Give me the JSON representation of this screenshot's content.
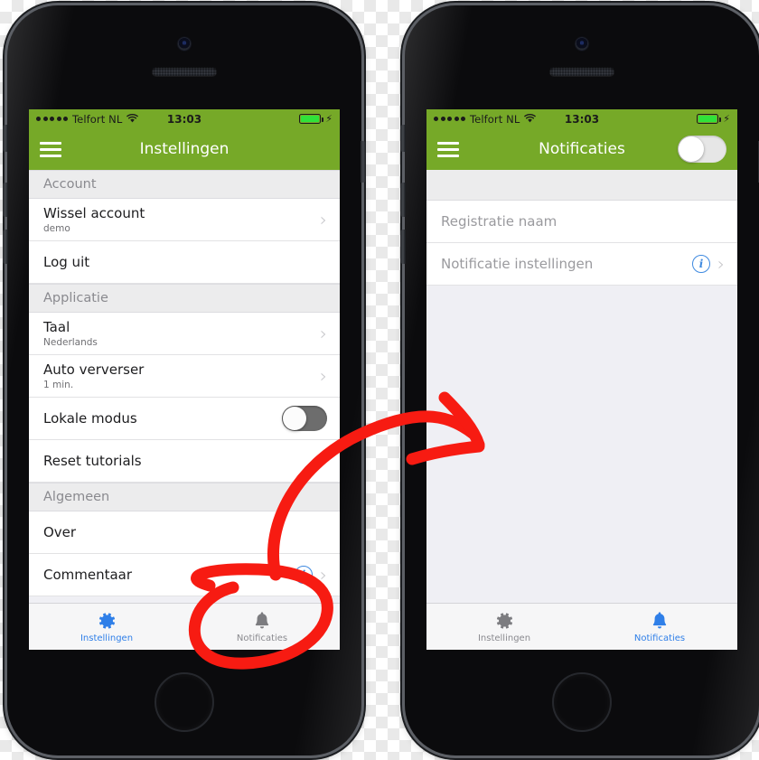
{
  "meta": {
    "accent_green": "#76a928",
    "accent_blue": "#2f7fe8",
    "annotation_red": "#f71b12",
    "inactive_gray": "#8a8a8f"
  },
  "status_bar": {
    "signal_dots": 5,
    "carrier": "Telfort NL",
    "wifi_icon": "wifi-icon",
    "time": "13:03",
    "battery_icon": "battery-full-icon",
    "charging_icon": "lightning-bolt-icon"
  },
  "phone_left": {
    "nav": {
      "menu_icon": "hamburger-menu-icon",
      "title": "Instellingen"
    },
    "sections": [
      {
        "header": "Account",
        "rows": [
          {
            "title": "Wissel account",
            "subtitle": "demo",
            "accessory": "chevron"
          },
          {
            "title": "Log uit",
            "subtitle": "",
            "accessory": "none"
          }
        ]
      },
      {
        "header": "Applicatie",
        "rows": [
          {
            "title": "Taal",
            "subtitle": "Nederlands",
            "accessory": "chevron"
          },
          {
            "title": "Auto ververser",
            "subtitle": "1 min.",
            "accessory": "chevron"
          },
          {
            "title": "Lokale modus",
            "subtitle": "",
            "accessory": "toggle",
            "toggle_on": false
          },
          {
            "title": "Reset tutorials",
            "subtitle": "",
            "accessory": "none"
          }
        ]
      },
      {
        "header": "Algemeen",
        "rows": [
          {
            "title": "Over",
            "subtitle": "",
            "accessory": "none"
          },
          {
            "title": "Commentaar",
            "subtitle": "",
            "accessory": "info-chevron"
          }
        ]
      }
    ],
    "tabs": [
      {
        "label": "Instellingen",
        "icon": "gear-icon",
        "active": true
      },
      {
        "label": "Notificaties",
        "icon": "bell-icon",
        "active": false
      }
    ]
  },
  "phone_right": {
    "nav": {
      "menu_icon": "hamburger-menu-icon",
      "title": "Notificaties",
      "toggle_on": false
    },
    "rows": [
      {
        "title": "Registratie naam",
        "accessory": "none",
        "disabled": true
      },
      {
        "title": "Notificatie instellingen",
        "accessory": "info-chevron",
        "disabled": true
      }
    ],
    "tabs": [
      {
        "label": "Instellingen",
        "icon": "gear-icon",
        "active": false
      },
      {
        "label": "Notificaties",
        "icon": "bell-icon",
        "active": true
      }
    ]
  },
  "annotation": {
    "ellipse_target": "Notificaties",
    "arrow_description": "curved-arrow-from-notificaties-tab-to-right-phone-screen"
  }
}
